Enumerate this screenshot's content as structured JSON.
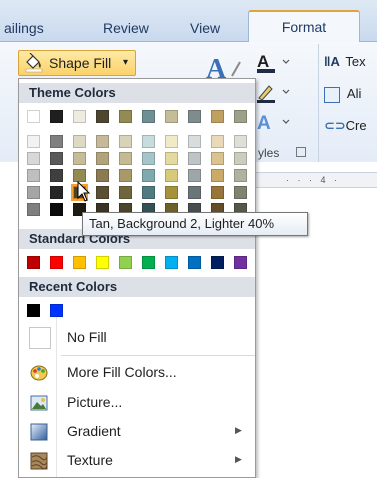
{
  "ribbon": {
    "tabs": [
      {
        "label": "ailings"
      },
      {
        "label": "Review"
      },
      {
        "label": "View"
      },
      {
        "label": "Format"
      }
    ],
    "shape_fill_label": "Shape Fill",
    "shape_fill_arrow": "▾",
    "right_group": {
      "text_direction": "Tex",
      "align_text": "Ali",
      "create_link": "Cre"
    },
    "styles_label": "yles",
    "ruler_marks": "· · · 4 ·"
  },
  "dropdown": {
    "theme_header": "Theme Colors",
    "standard_header": "Standard Colors",
    "recent_header": "Recent Colors",
    "theme_top_row": [
      "#ffffff",
      "#1f1f1f",
      "#eeece1",
      "#4f4631",
      "#948a54",
      "#6e8f93",
      "#c4bd97",
      "#7f8c8d",
      "#c0a060",
      "#9ea189"
    ],
    "theme_shades": [
      [
        "#f2f2f2",
        "#7f7f7f",
        "#ddd9c3",
        "#c6b99a",
        "#d8d2b8",
        "#c8dcde",
        "#f0ebc6",
        "#d8dcdd",
        "#ead9b8",
        "#dedfd8"
      ],
      [
        "#d8d8d8",
        "#595959",
        "#c4bd97",
        "#b2a37c",
        "#c4bb92",
        "#a6c5c8",
        "#e4daa0",
        "#bfc4c7",
        "#dbc38f",
        "#cbcdbf"
      ],
      [
        "#bfbfbf",
        "#3f3f3f",
        "#948a54",
        "#8c7a52",
        "#a89a68",
        "#7ea9ae",
        "#d8c87a",
        "#9ea6aa",
        "#c9aa66",
        "#b0b29f"
      ],
      [
        "#a5a5a5",
        "#262626",
        "#4a452a",
        "#5a4e34",
        "#70663d",
        "#4e7a80",
        "#a6923a",
        "#6a7579",
        "#98753a",
        "#80836e"
      ],
      [
        "#7f7f7f",
        "#0c0c0c",
        "#1d1b10",
        "#3a3222",
        "#4a4428",
        "#345256",
        "#6e6126",
        "#474e51",
        "#654e27",
        "#565849"
      ]
    ],
    "highlight_swatch": {
      "row": 3,
      "col": 2
    },
    "standard_colors": [
      "#c00000",
      "#ff0000",
      "#ffc000",
      "#ffff00",
      "#92d050",
      "#00b050",
      "#00b0f0",
      "#0070c0",
      "#002060",
      "#7030a0"
    ],
    "recent_colors": [
      "#000000",
      "#0033ff"
    ],
    "menu_items": [
      {
        "label": "No Fill",
        "icon": "no-fill-icon",
        "has_submenu": false
      },
      {
        "label": "More Fill Colors...",
        "icon": "palette-icon",
        "has_submenu": false
      },
      {
        "label": "Picture...",
        "icon": "picture-icon",
        "has_submenu": false
      },
      {
        "label": "Gradient",
        "icon": "gradient-icon",
        "has_submenu": true
      },
      {
        "label": "Texture",
        "icon": "texture-icon",
        "has_submenu": true
      }
    ]
  },
  "tooltip": {
    "text": "Tan, Background 2, Lighter 40%"
  },
  "colors": {
    "accent_border": "#f0a236",
    "button_fill": "#fbd26a",
    "section_header_bg": "#dde1e7"
  }
}
